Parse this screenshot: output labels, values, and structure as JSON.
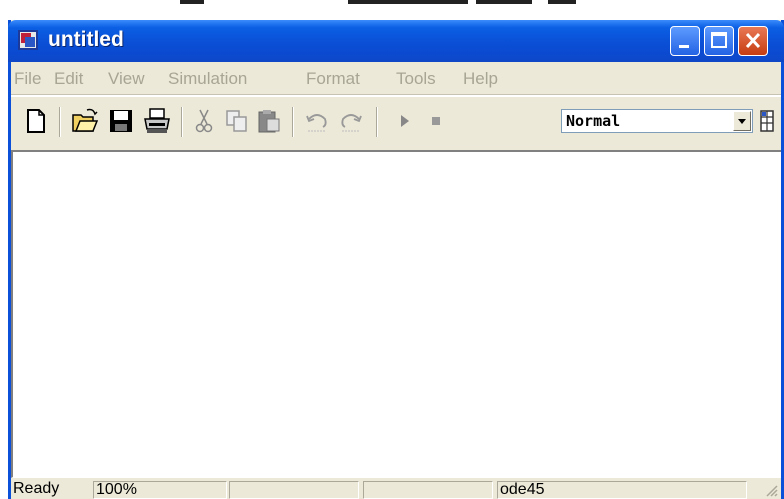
{
  "window": {
    "title": "untitled"
  },
  "menu": {
    "items": [
      "File",
      "Edit",
      "View",
      "Simulation",
      "Format",
      "Tools",
      "Help"
    ]
  },
  "toolbar": {
    "buttons": [
      "new-model-icon",
      "open-folder-icon",
      "save-icon",
      "print-icon",
      "cut-icon",
      "copy-icon",
      "paste-icon",
      "undo-icon",
      "redo-icon",
      "start-simulation-icon",
      "stop-simulation-icon",
      "library-browser-icon"
    ],
    "simulation_mode": "Normal"
  },
  "status": {
    "state": "Ready",
    "zoom": "100%",
    "solver": "ode45"
  },
  "colors": {
    "titlebar": "#0a4fd6",
    "window_border": "#0a50d8",
    "chrome": "#ece9d8",
    "close_button": "#c63d12"
  }
}
